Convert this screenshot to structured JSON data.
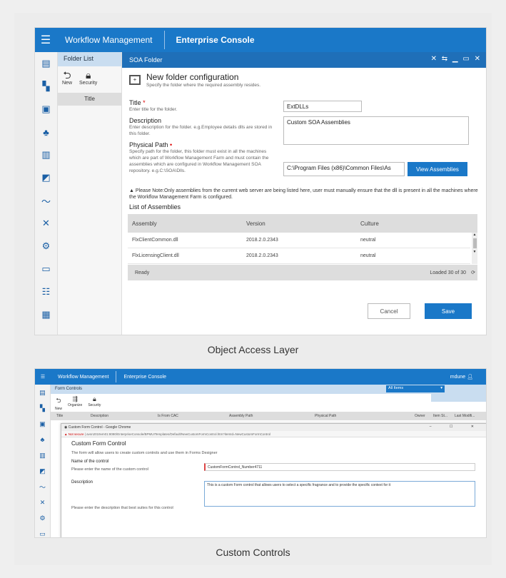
{
  "top": {
    "caption": "Object Access Layer",
    "topbar": {
      "app": "Workflow Management",
      "section": "Enterprise Console"
    },
    "folder_panel": {
      "title": "Folder List",
      "new": "New",
      "security": "Security",
      "col_title": "Title"
    },
    "dialog": {
      "bar_title": "SOA Folder",
      "heading": "New folder configuration",
      "subheading": "Specify the folder where the required assembly resides.",
      "title_label": "Title",
      "title_help": "Enter title for the folder.",
      "title_value": "ExtDLLs",
      "desc_label": "Description",
      "desc_help": "Enter description for the folder. e.g.Employee details dlls are stored in this folder.",
      "desc_value": "Custom SOA Assemblies",
      "path_label": "Physical Path",
      "path_help": "Specify path for the folder, this folder must exist in all the machines which are part of Workflow Management Farm and must contain the assemblies which are configured in Workflow Management SOA repository. e.g.C:\\SOA\\Dlls.",
      "path_value": "C:\\Program Files (x86)\\Common Files\\As",
      "view_btn": "View Assemblies",
      "note": "Please Note:Only assemblies from the current web server are being listed here, user must manually ensure that the dll is present in all the machines where the Workflow Management Farm is configured.",
      "list_title": "List of Assemblies",
      "columns": [
        "Assembly",
        "Version",
        "Culture"
      ],
      "rows": [
        [
          "FlxClientCommon.dll",
          "2018.2.0.2343",
          "neutral"
        ],
        [
          "FlxLicensingClient.dll",
          "2018.2.0.2343",
          "neutral"
        ]
      ],
      "status": "Ready",
      "loaded": "Loaded 30 of 30",
      "cancel": "Cancel",
      "save": "Save"
    }
  },
  "bottom": {
    "caption": "Custom Controls",
    "topbar": {
      "app": "Workflow Management",
      "section": "Enterprise Console",
      "user": "mdune"
    },
    "form_controls": "Form Controls",
    "filter": "All Items",
    "tools": {
      "new": "New",
      "organize": "Organize",
      "security": "Security"
    },
    "columns": [
      "Title",
      "Description",
      "Is From CAC",
      "Assembly Path",
      "Physical Path",
      "Owner",
      "Item St...",
      "Last Modifi..."
    ],
    "popup_title": "Custom Form Control - Google Chrome",
    "not_secure": "Not secure",
    "url": "avsn2019vm01:8080/EnterpriseConsole/BPMUITemplates/Default/NewCustomFormControl.htm?itemId=NewCustomFormControl",
    "heading": "Custom Form Control",
    "subheading": "The form will allow users to create custom controls and use them in Forms Designer",
    "name_label": "Name of the control",
    "name_help": "Please enter the name of the custom control",
    "name_value": "CustomFormControl_Number4711",
    "desc_label": "Description",
    "desc_help": "Please enter the description that best suites for this control",
    "desc_value": "This is a custom Form control that allows users to select a specific fragrance and to provide the specific context for it"
  }
}
